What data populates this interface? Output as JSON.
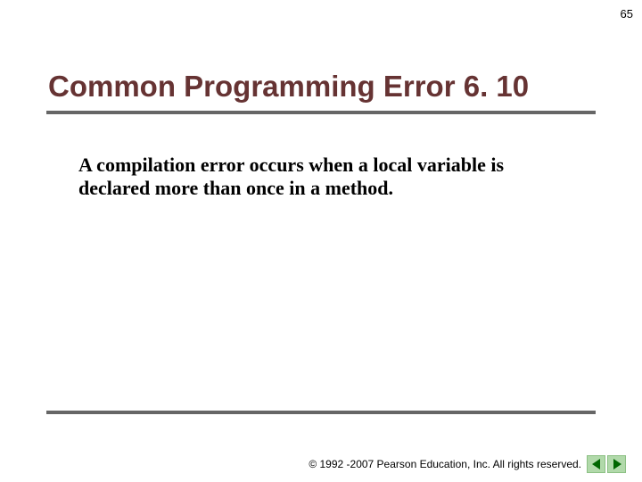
{
  "page_number": "65",
  "title": "Common Programming Error 6. 10",
  "body": "A compilation error occurs when a local variable is declared more than once in a method.",
  "footer": {
    "copyright": "© 1992 -2007 Pearson Education, Inc.  All rights reserved."
  }
}
